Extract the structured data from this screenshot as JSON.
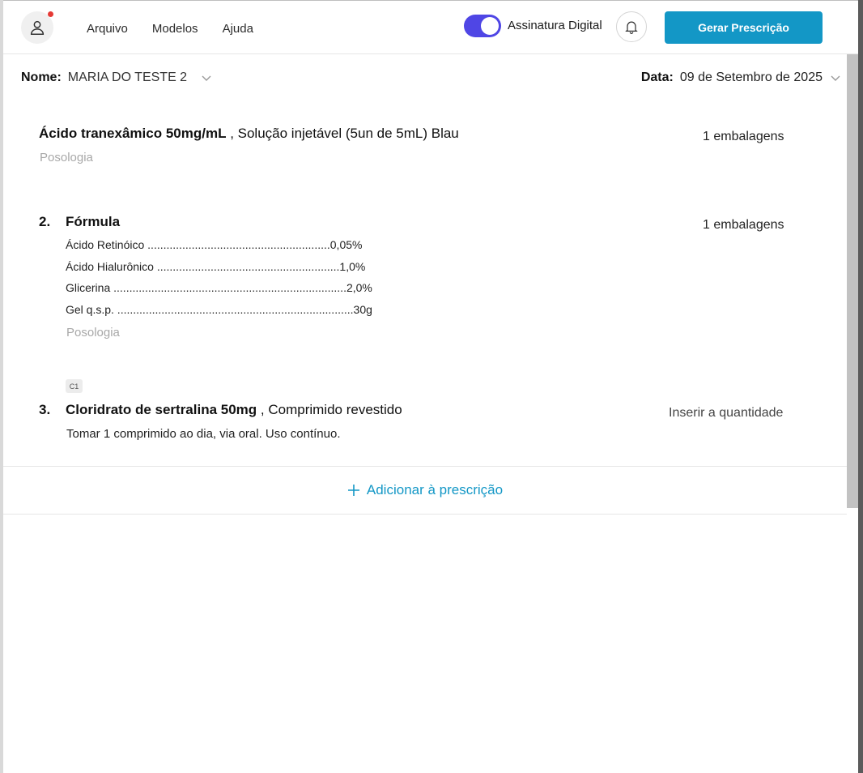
{
  "header": {
    "menu": [
      "Arquivo",
      "Modelos",
      "Ajuda"
    ],
    "toggle_label": "Assinatura Digital",
    "toggle_on": true,
    "generate_button": "Gerar Prescrição",
    "avatar_icon": "user-icon",
    "bell_icon": "bell-icon",
    "accent_color": "#1397c6",
    "toggle_color": "#4f46e5"
  },
  "patient": {
    "name_label": "Nome:",
    "name_value": "MARIA DO TESTE 2",
    "date_label": "Data:",
    "date_value": "09 de Setembro de 2025"
  },
  "items": [
    {
      "title_bold": "Ácido tranexâmico 50mg/mL",
      "title_rest": " , Solução injetável (5un de 5mL) Blau",
      "posology": "Posologia",
      "quantity": "1 embalagens"
    },
    {
      "number": "2.",
      "title": "Fórmula",
      "formula": [
        "Ácido Retinóico ..........................................................0,05%",
        "Ácido Hialurônico ..........................................................1,0%",
        "Glicerina ..........................................................................2,0%",
        "Gel q.s.p. ...........................................................................30g"
      ],
      "posology": "Posologia",
      "quantity": "1 embalagens"
    },
    {
      "number": "3.",
      "badge": "C1",
      "title_bold": "Cloridrato de sertralina 50mg",
      "title_rest": " , Comprimido revestido",
      "instructions": "Tomar 1 comprimido ao dia, via oral. Uso contínuo.",
      "quantity": "Inserir a quantidade"
    }
  ],
  "add_button": {
    "icon": "plus-icon",
    "label": "Adicionar à prescrição"
  }
}
